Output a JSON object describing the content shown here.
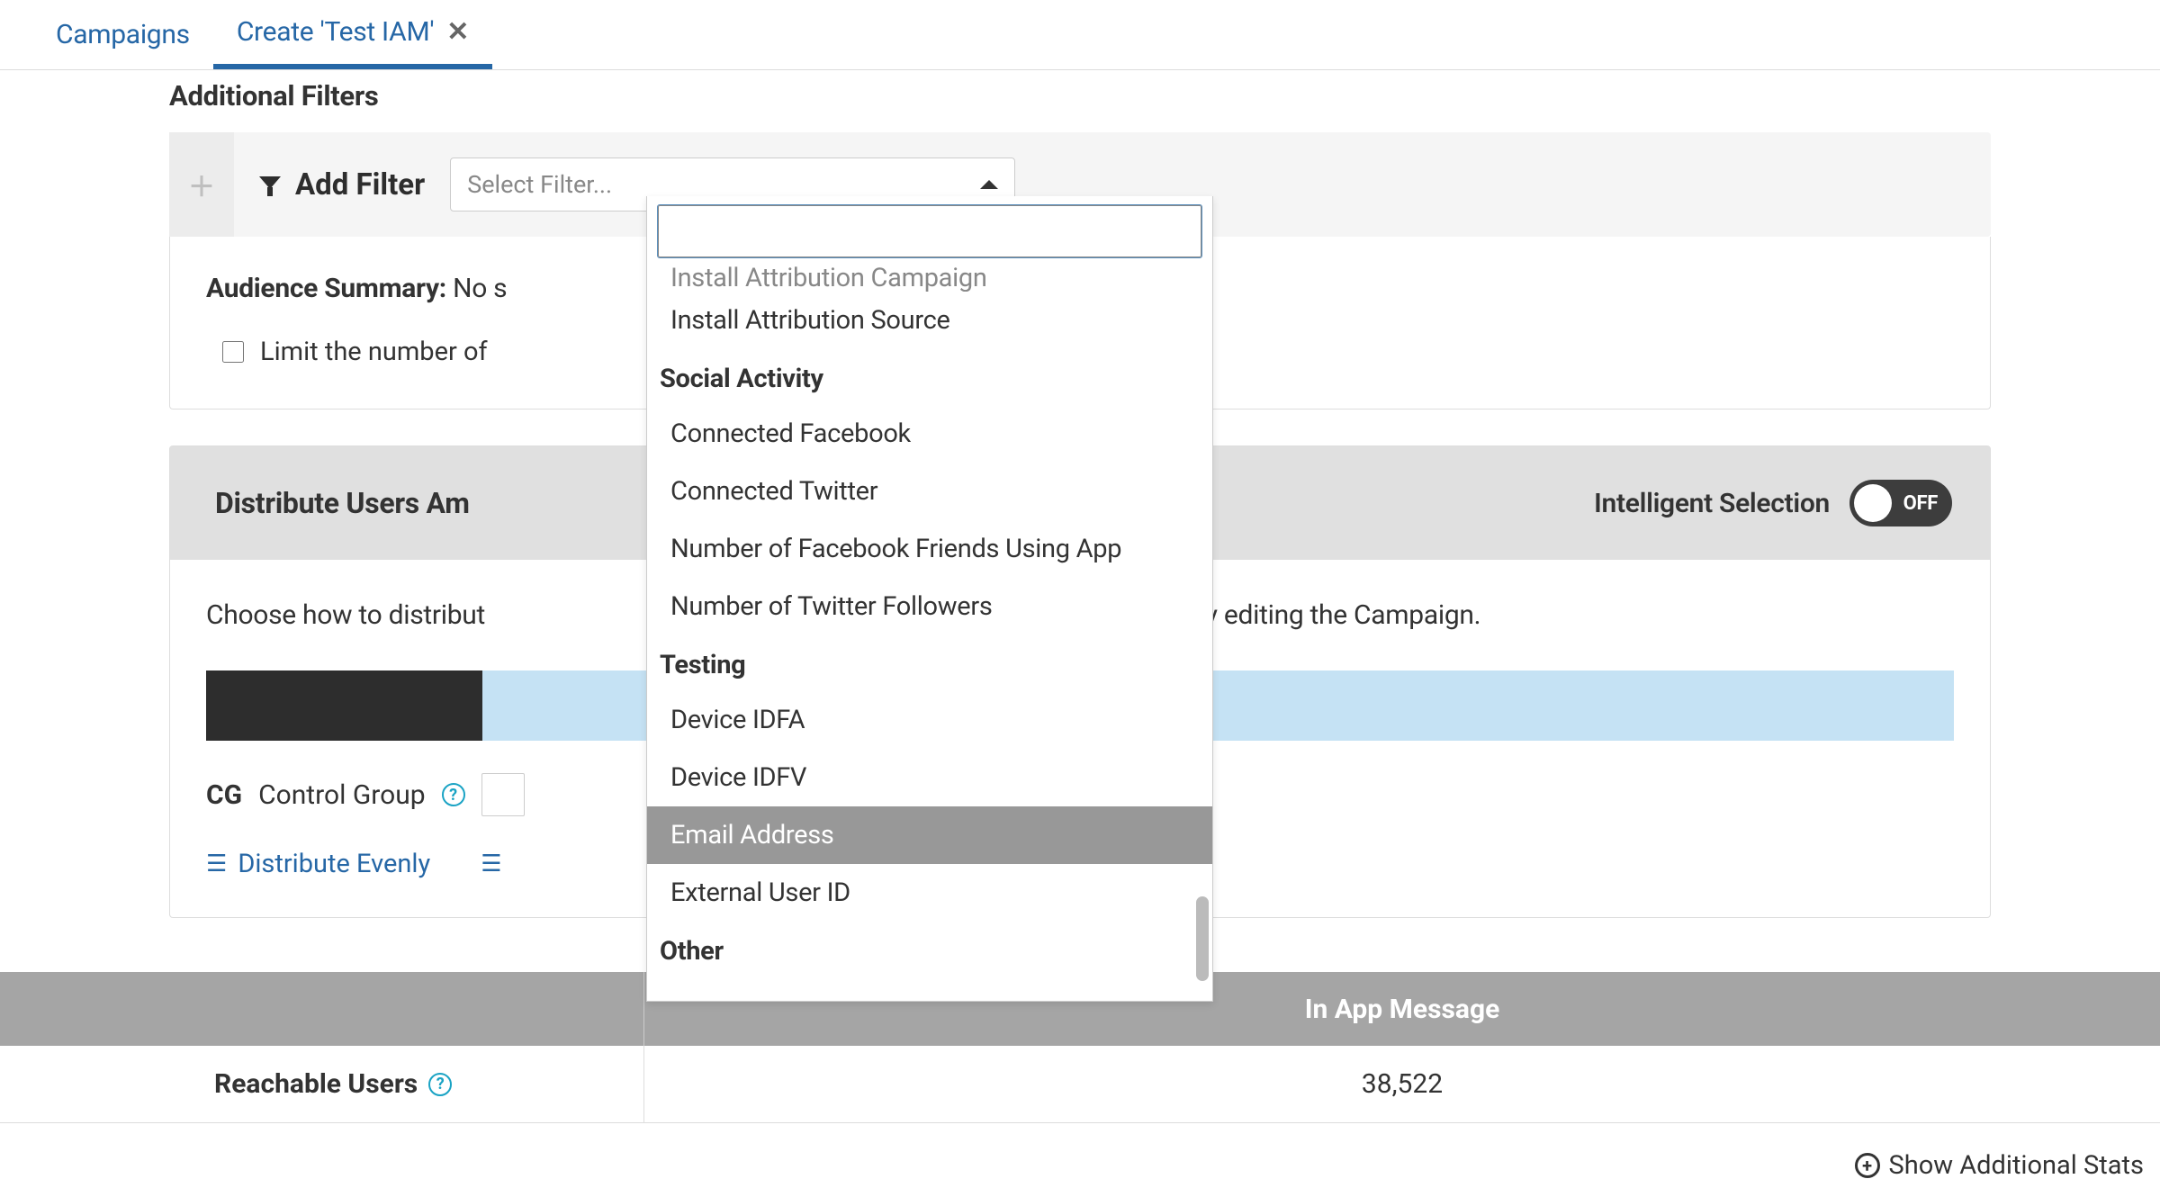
{
  "tabs": {
    "campaigns": "Campaigns",
    "create": "Create 'Test IAM'"
  },
  "filters": {
    "heading": "Additional Filters",
    "add_label": "Add Filter",
    "select_placeholder": "Select Filter..."
  },
  "audience": {
    "summary_label": "Audience Summary:",
    "summary_text_prefix": "No s",
    "limit_label_prefix": "Limit the number of"
  },
  "distribute": {
    "heading_prefix": "Distribute Users Am",
    "intelligent_label": "Intelligent Selection",
    "toggle_state": "OFF",
    "desc_prefix": "Choose how to distribut",
    "desc_suffix": "anged later by editing the Campaign.",
    "cg_abbrev": "CG",
    "cg_label": "Control Group",
    "link_even": "Distribute Evenly",
    "link_partial": ""
  },
  "dropdown": {
    "truncated_top": "Install Attribution Campaign",
    "items_pre_group": [
      "Install Attribution Source"
    ],
    "group1_header": "Social Activity",
    "group1_items": [
      "Connected Facebook",
      "Connected Twitter",
      "Number of Facebook Friends Using App",
      "Number of Twitter Followers"
    ],
    "group2_header": "Testing",
    "group2_items": [
      "Device IDFA",
      "Device IDFV",
      "Email Address",
      "External User ID"
    ],
    "group3_header": "Other",
    "highlighted": "Email Address"
  },
  "stats": {
    "header_iam": "In App Message",
    "row1_label": "Reachable Users",
    "row1_value": "38,522"
  },
  "footer": {
    "show_stats": "Show Additional Stats"
  }
}
